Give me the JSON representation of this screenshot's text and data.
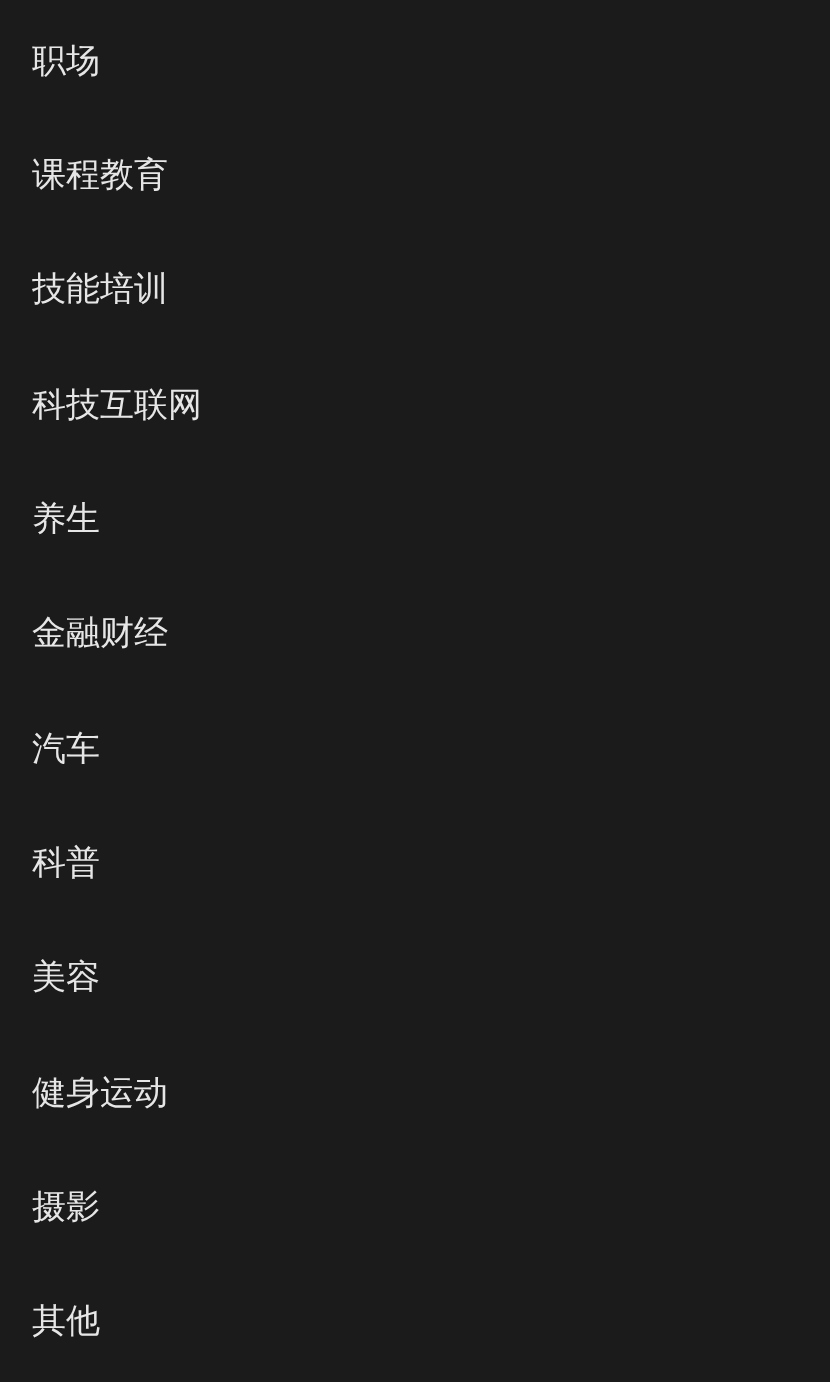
{
  "list": {
    "items": [
      {
        "label": "职场"
      },
      {
        "label": "课程教育"
      },
      {
        "label": "技能培训"
      },
      {
        "label": "科技互联网"
      },
      {
        "label": "养生"
      },
      {
        "label": "金融财经"
      },
      {
        "label": "汽车"
      },
      {
        "label": "科普"
      },
      {
        "label": "美容"
      },
      {
        "label": "健身运动"
      },
      {
        "label": "摄影"
      },
      {
        "label": "其他"
      }
    ]
  }
}
